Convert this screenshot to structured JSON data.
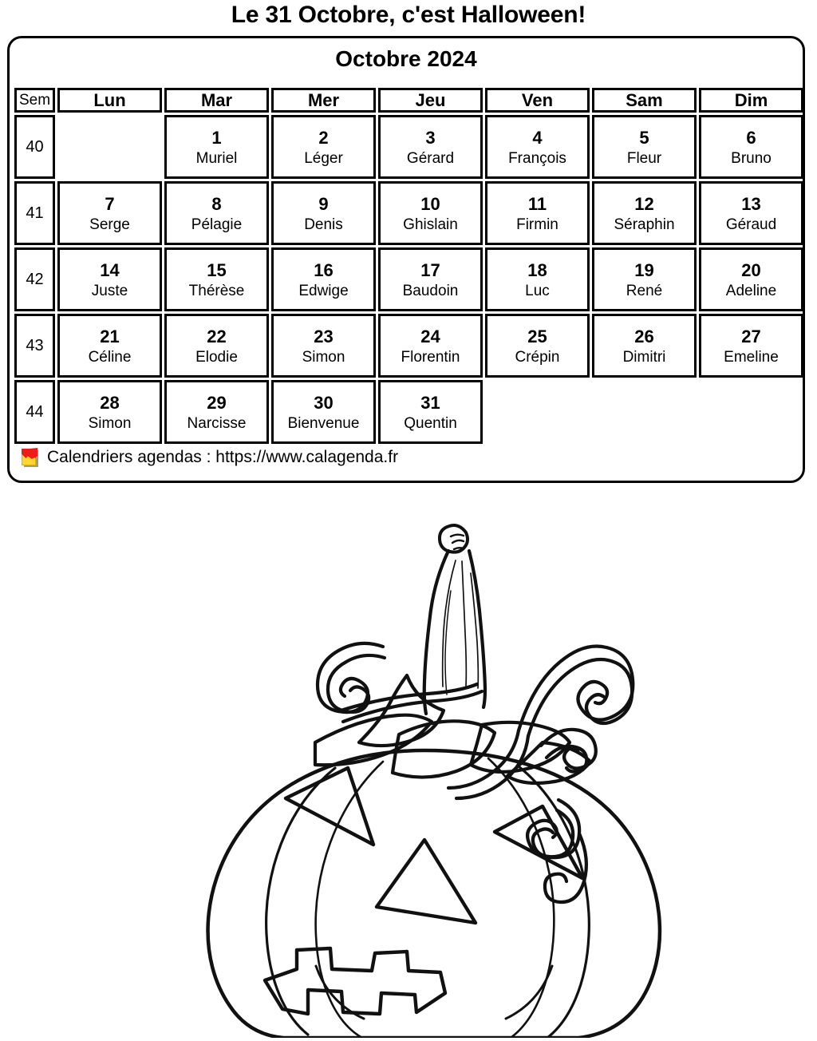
{
  "page": {
    "title": "Le 31 Octobre, c'est Halloween!"
  },
  "calendar": {
    "month_title": "Octobre 2024",
    "week_header": "Sem",
    "day_headers": [
      "Lun",
      "Mar",
      "Mer",
      "Jeu",
      "Ven",
      "Sam",
      "Dim"
    ],
    "weeks": [
      {
        "week_number": "40",
        "days": [
          {
            "num": "",
            "saint": ""
          },
          {
            "num": "1",
            "saint": "Muriel"
          },
          {
            "num": "2",
            "saint": "Léger"
          },
          {
            "num": "3",
            "saint": "Gérard"
          },
          {
            "num": "4",
            "saint": "François"
          },
          {
            "num": "5",
            "saint": "Fleur"
          },
          {
            "num": "6",
            "saint": "Bruno"
          }
        ]
      },
      {
        "week_number": "41",
        "days": [
          {
            "num": "7",
            "saint": "Serge"
          },
          {
            "num": "8",
            "saint": "Pélagie"
          },
          {
            "num": "9",
            "saint": "Denis"
          },
          {
            "num": "10",
            "saint": "Ghislain"
          },
          {
            "num": "11",
            "saint": "Firmin"
          },
          {
            "num": "12",
            "saint": "Séraphin"
          },
          {
            "num": "13",
            "saint": "Géraud"
          }
        ]
      },
      {
        "week_number": "42",
        "days": [
          {
            "num": "14",
            "saint": "Juste"
          },
          {
            "num": "15",
            "saint": "Thérèse"
          },
          {
            "num": "16",
            "saint": "Edwige"
          },
          {
            "num": "17",
            "saint": "Baudoin"
          },
          {
            "num": "18",
            "saint": "Luc"
          },
          {
            "num": "19",
            "saint": "René"
          },
          {
            "num": "20",
            "saint": "Adeline"
          }
        ]
      },
      {
        "week_number": "43",
        "days": [
          {
            "num": "21",
            "saint": "Céline"
          },
          {
            "num": "22",
            "saint": "Elodie"
          },
          {
            "num": "23",
            "saint": "Simon"
          },
          {
            "num": "24",
            "saint": "Florentin"
          },
          {
            "num": "25",
            "saint": "Crépin"
          },
          {
            "num": "26",
            "saint": "Dimitri"
          },
          {
            "num": "27",
            "saint": "Emeline"
          }
        ]
      },
      {
        "week_number": "44",
        "days": [
          {
            "num": "28",
            "saint": "Simon"
          },
          {
            "num": "29",
            "saint": "Narcisse"
          },
          {
            "num": "30",
            "saint": "Bienvenue"
          },
          {
            "num": "31",
            "saint": "Quentin"
          },
          {
            "num": "",
            "saint": ""
          },
          {
            "num": "",
            "saint": ""
          },
          {
            "num": "",
            "saint": ""
          }
        ]
      }
    ],
    "footer": {
      "logo_name": "calagenda-logo-icon",
      "text": "Calendriers agendas : https://www.calagenda.fr"
    }
  },
  "illustration": {
    "name": "halloween-pumpkin-line-drawing",
    "description": "Jack-o'-lantern coloring outline with curly vines, stem, leaves, triangular eyes and nose, zig-zag mouth",
    "stroke_color": "#111111",
    "fill_color": "#ffffff"
  }
}
